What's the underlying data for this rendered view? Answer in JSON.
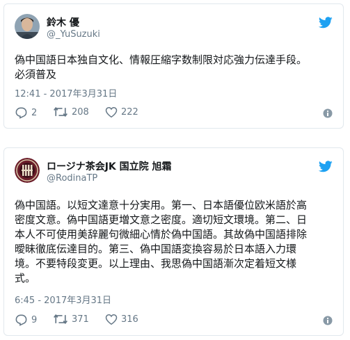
{
  "colors": {
    "twitter_blue": "#1da1f2",
    "muted": "#657786",
    "text": "#14171a",
    "border": "#e1e8ed"
  },
  "tweets": [
    {
      "display_name": "鈴木 優",
      "handle": "@_YuSuzuki",
      "text_lines": [
        "偽中国語日本独自文化、情報圧縮字数制限対応強力伝達手段。",
        "必須普及"
      ],
      "timestamp": "12:41 - 2017年3月31日",
      "replies": "2",
      "retweets": "208",
      "likes": "222",
      "icons": [
        "avatar-photo",
        "twitter-bird-icon",
        "reply-icon",
        "retweet-icon",
        "heart-icon",
        "info-icon"
      ]
    },
    {
      "display_name": "ロージナ茶会JK 国立院 旭霜",
      "handle": "@RodinaTP",
      "text_lines": [
        "偽中国語。以短文達意十分実用。第一、日本語優位欧米語於高",
        "密度文意。偽中国語更増文意之密度。適切短文環境。第二、日",
        "本人不可使用美辞麗句微細心情於偽中国語。其故偽中国語排除",
        "曖昧徹底伝達目的。第三、偽中国語変換容易於日本語入力環",
        "境。不要特段変更。以上理由、我思偽中国語漸次定着短文様",
        "式。"
      ],
      "timestamp": "6:45 - 2017年3月31日",
      "replies": "9",
      "retweets": "371",
      "likes": "316",
      "icons": [
        "avatar-emblem",
        "twitter-bird-icon",
        "reply-icon",
        "retweet-icon",
        "heart-icon",
        "info-icon"
      ]
    }
  ]
}
